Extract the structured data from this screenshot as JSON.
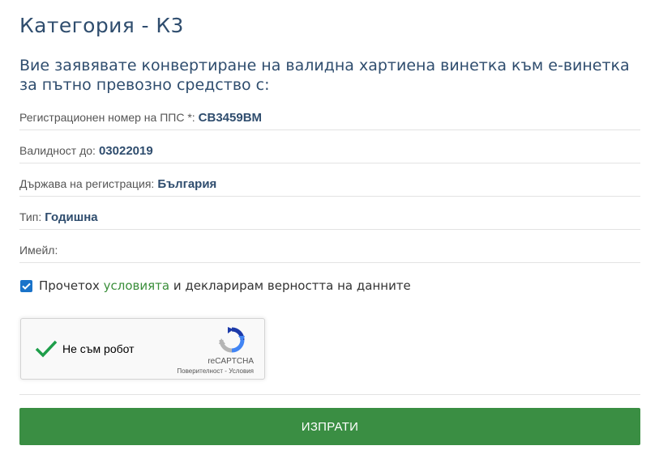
{
  "page": {
    "title": "Категория - К3",
    "intro_line1": "Вие заявявате конвертиране на валидна хартиена винетка към е-винетка",
    "intro_line2": "за пътно превозно средство с:"
  },
  "fields": [
    {
      "label": "Регистрационен номер на ППС *:",
      "value": "СВ3459ВМ"
    },
    {
      "label": "Валидност до:",
      "value": "03022019"
    },
    {
      "label": "Държава на регистрация:",
      "value": "България"
    },
    {
      "label": "Тип:",
      "value": "Годишна"
    },
    {
      "label": "Имейл:",
      "value": ""
    }
  ],
  "agreement": {
    "checked": true,
    "text_before": "Прочетох ",
    "link_text": "условията",
    "text_after": " и декларирам верността на данните"
  },
  "recaptcha": {
    "label": "Не съм робот",
    "brand": "reCAPTCHA",
    "privacy": "Поверителност",
    "separator": " - ",
    "terms": "Условия",
    "checked": true
  },
  "submit": {
    "label": "ИЗПРАТИ"
  },
  "colors": {
    "heading": "#2f4d6e",
    "link": "#3a8e3a",
    "button": "#3a8e43",
    "checkbox": "#1a73c9"
  }
}
